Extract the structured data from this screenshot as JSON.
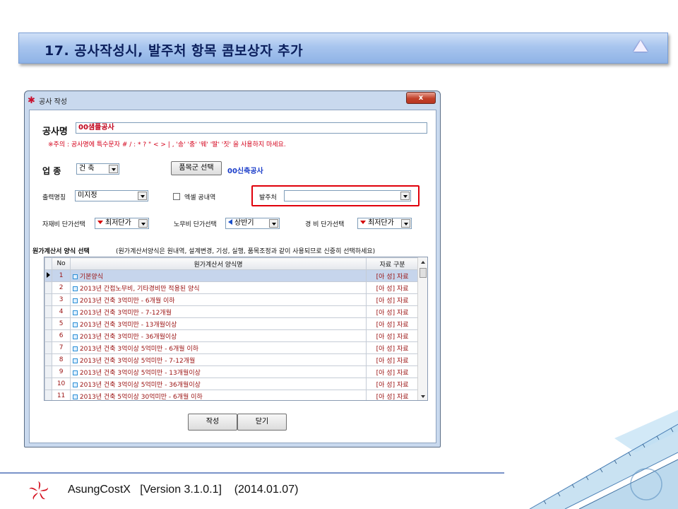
{
  "slide": {
    "title": "17. 공사작성시, 발주처 항목 콤보상자 추가"
  },
  "window": {
    "title": "공사 작성",
    "close": "x"
  },
  "form": {
    "project_name_label": "공사명",
    "project_name_value": "00샘플공사",
    "warning": "※주의 : 공사명에 특수문자 # / : * ? \" < > | , '송' '충' '웨' '딸' '짓' 을 사용하지 마세요.",
    "industry_label": "업    종",
    "industry_value": "건 축",
    "category_button": "품목군 선택",
    "category_value": "00신축공사",
    "output_name_label": "출력명칭",
    "output_name_value": "미지정",
    "excel_label": "엑셀 공내역",
    "client_label": "발주처",
    "client_value": "",
    "material_label": "자재비 단가선택",
    "material_value": "최저단가",
    "labor_label": "노무비 단가선택",
    "labor_value": "상반기",
    "expense_label": "경    비 단가선택",
    "expense_value": "최저단가",
    "section_title": "원가계산서 양식 선택",
    "section_note": "(원가계산서양식은 원내역, 설계변경, 기성, 실행, 품목조정과 같이 사용되므로 신중히 선택하세요)"
  },
  "grid": {
    "columns": [
      "No",
      "원가계산서 양식명",
      "자료 구분"
    ],
    "rows": [
      {
        "no": "1",
        "name": "기본양식",
        "type": "[아  성] 자료"
      },
      {
        "no": "2",
        "name": "2013년 간접노무비, 기타경비만 적용된 양식",
        "type": "[아  성] 자료"
      },
      {
        "no": "3",
        "name": "2013년 건축 3억미만 - 6개월 이하",
        "type": "[아  성] 자료"
      },
      {
        "no": "4",
        "name": "2013년 건축 3억미만 - 7-12개월",
        "type": "[아  성] 자료"
      },
      {
        "no": "5",
        "name": "2013년 건축 3억미만 - 13개월이상",
        "type": "[아  성] 자료"
      },
      {
        "no": "6",
        "name": "2013년 건축 3억미만  - 36개월이상",
        "type": "[아  성] 자료"
      },
      {
        "no": "7",
        "name": "2013년 건축 3억이상 5억미만 - 6개월 이하",
        "type": "[아  성] 자료"
      },
      {
        "no": "8",
        "name": "2013년 건축 3억이상 5억미만 - 7-12개월",
        "type": "[아  성] 자료"
      },
      {
        "no": "9",
        "name": "2013년 건축 3억이상 5억미만 - 13개월이상",
        "type": "[아  성] 자료"
      },
      {
        "no": "10",
        "name": "2013년 건축 3억이상 5억미만 - 36개월이상",
        "type": "[아  성] 자료"
      },
      {
        "no": "11",
        "name": "2013년 건축 5억이상 30억미만 - 6개월 이하",
        "type": "[아  성] 자료"
      }
    ]
  },
  "buttons": {
    "create": "작성",
    "close": "닫기"
  },
  "footer": {
    "text": "AsungCostX   [Version 3.1.0.1]    (2014.01.07)"
  },
  "colors": {
    "highlight": "#e0000b",
    "header_blue": "#a8c5ee",
    "grid_text": "#9a1010"
  }
}
